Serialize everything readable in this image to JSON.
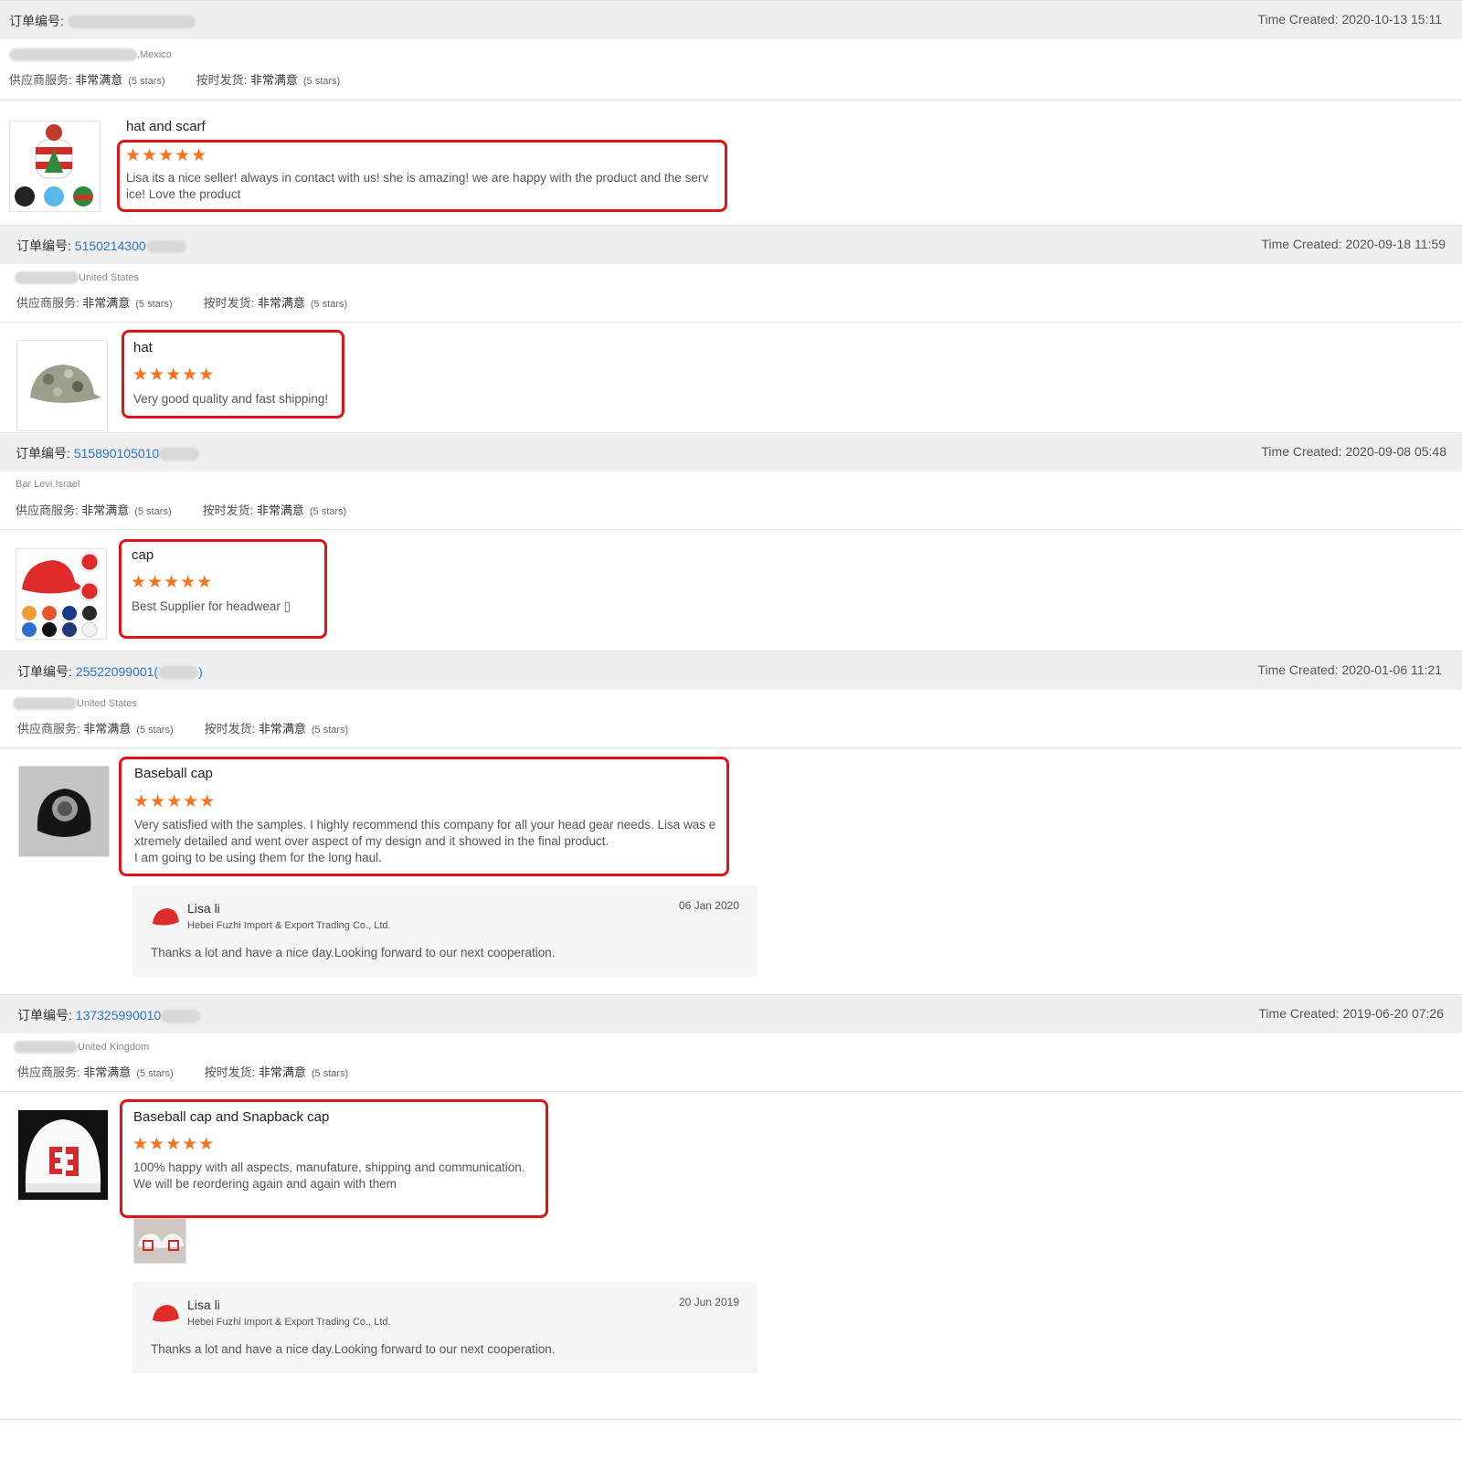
{
  "labels": {
    "order_no": "订单编号:",
    "supplier_service": "供应商服务:",
    "on_time_delivery": "按时发货:",
    "very_satisfied": "非常满意",
    "five_stars": "(5 stars)",
    "stars": "★★★★★"
  },
  "orders": [
    {
      "order_number": "",
      "time_created": "Time Created: 2020-10-13 15:11",
      "buyer_location": ",Mexico",
      "product_title": "hat and scarf",
      "review_text": "Lisa its a nice seller! always in contact with us! she is amazing!  we are happy with the product and the serv\nice! Love the product"
    },
    {
      "order_number": "5150214300",
      "time_created": "Time Created: 2020-09-18 11:59",
      "buyer_location": "United States",
      "product_title": "hat",
      "review_text": "Very good quality and fast shipping!"
    },
    {
      "order_number": "515890105010",
      "time_created": "Time Created: 2020-09-08 05:48",
      "buyer_location": "Bar Levi,Israel",
      "product_title": "cap",
      "review_text": "Best Supplier for headwear ▯"
    },
    {
      "order_number": "25522099001(",
      "order_number_suffix": ")",
      "time_created": "Time Created: 2020-01-06 11:21",
      "buyer_location": "United States",
      "product_title": "Baseball cap",
      "review_text": "Very satisfied with the samples. I highly recommend this company for all your head gear needs. Lisa was e\nxtremely detailed and went over aspect of my design and it showed in the final product.\nI am going to be using them for the long haul.",
      "reply": {
        "name": "Lisa li",
        "company": "Hebei Fuzhi Import & Export Trading Co., Ltd.",
        "date": "06 Jan 2020",
        "message": "Thanks a lot and have a nice day.Looking forward to our next cooperation."
      }
    },
    {
      "order_number": "137325990010",
      "time_created": "Time Created: 2019-06-20 07:26",
      "buyer_location": "United Kingdom",
      "product_title": "Baseball cap and Snapback cap",
      "review_text": "100% happy with all aspects, manufature, shipping and communication.\nWe will be reordering again and again with them",
      "reply": {
        "name": "Lisa li",
        "company": "Hebei Fuzhi Import & Export Trading Co., Ltd.",
        "date": "20 Jun 2019",
        "message": "Thanks a lot and have a nice day.Looking forward to our next cooperation."
      }
    }
  ],
  "colors": {
    "highlight_border": "#e01418",
    "star": "#f5731e",
    "order_link": "#2a74c9",
    "header_bg": "#efefef"
  }
}
